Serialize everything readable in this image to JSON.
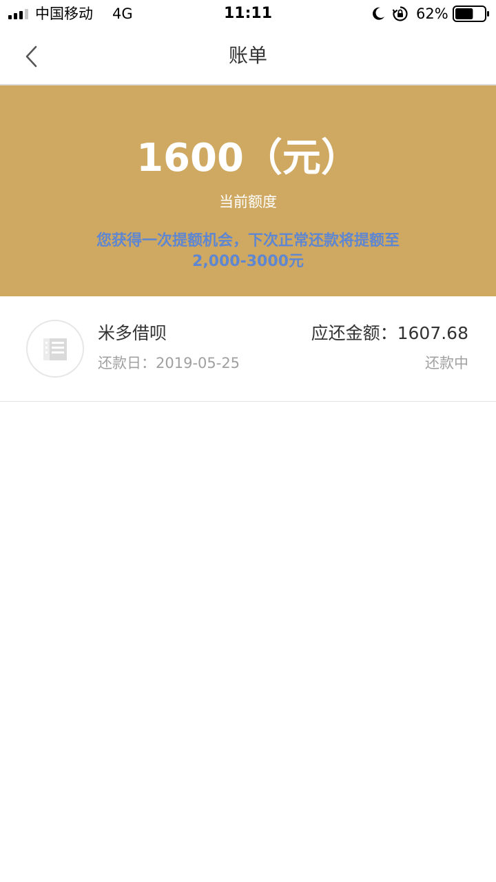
{
  "status_bar": {
    "carrier": "中国移动",
    "network": "4G",
    "time": "11:11",
    "battery": "62%",
    "battery_level": 0.62
  },
  "nav": {
    "title": "账单"
  },
  "banner": {
    "amount": "1600（元）",
    "limit_label": "当前额度",
    "promo_line1": "您获得一次提额机会，下次正常还款将提额至",
    "promo_line2": "2,000-3000元",
    "color": "#cfa962"
  },
  "bill": {
    "lender": "米多借呗",
    "due_date": "还款日：2019-05-25",
    "amount_due": "应还金额：1607.68",
    "status": "还款中"
  }
}
